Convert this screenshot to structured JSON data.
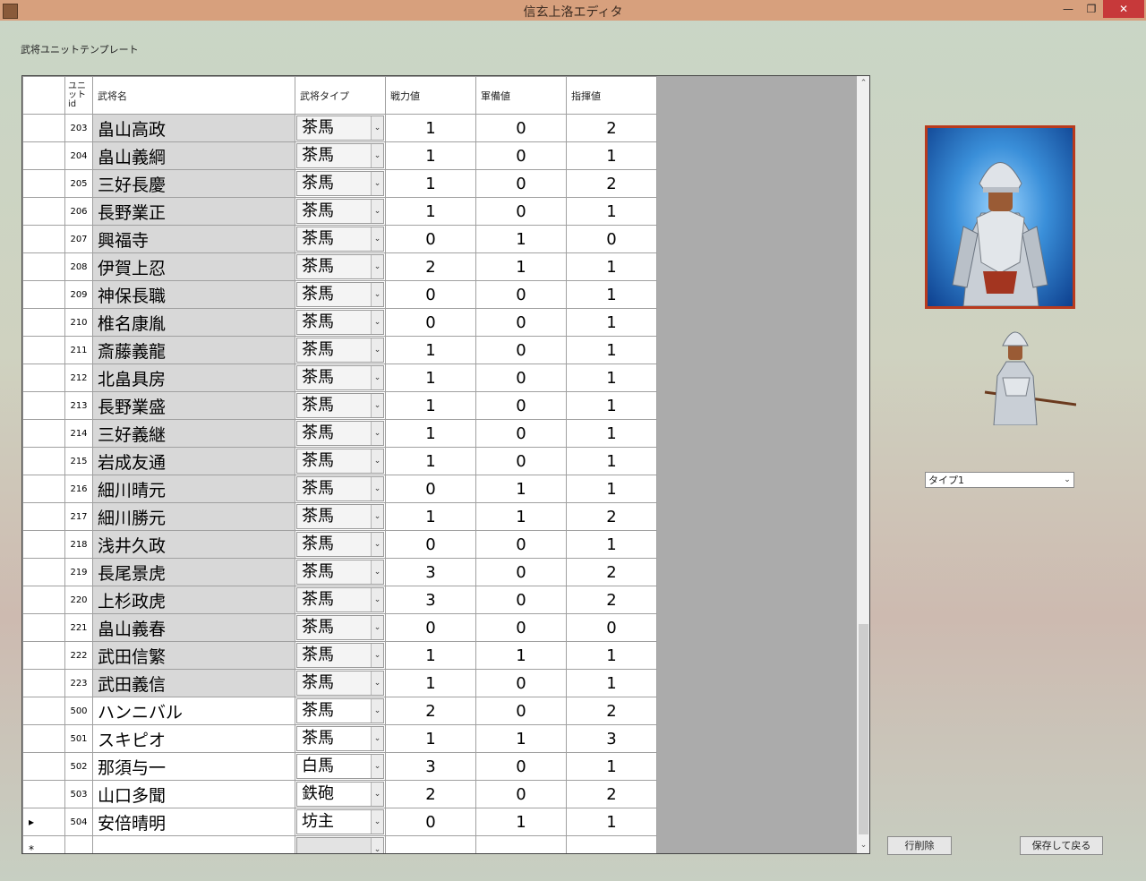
{
  "window": {
    "title": "信玄上洛エディタ",
    "controls": {
      "minimize": "—",
      "maximize": "❐",
      "close": "✕"
    }
  },
  "section_label": "武将ユニットテンプレート",
  "grid": {
    "headers": {
      "id": "ユニ\nット\nid",
      "name": "武将名",
      "type": "武将タイプ",
      "power": "戦力値",
      "armament": "軍備値",
      "command": "指揮値"
    },
    "rows": [
      {
        "id": "203",
        "name": "畠山高政",
        "type": "茶馬",
        "power": "1",
        "armament": "0",
        "command": "2",
        "gray": true
      },
      {
        "id": "204",
        "name": "畠山義綱",
        "type": "茶馬",
        "power": "1",
        "armament": "0",
        "command": "1",
        "gray": true
      },
      {
        "id": "205",
        "name": "三好長慶",
        "type": "茶馬",
        "power": "1",
        "armament": "0",
        "command": "2",
        "gray": true
      },
      {
        "id": "206",
        "name": "長野業正",
        "type": "茶馬",
        "power": "1",
        "armament": "0",
        "command": "1",
        "gray": true
      },
      {
        "id": "207",
        "name": "興福寺",
        "type": "茶馬",
        "power": "0",
        "armament": "1",
        "command": "0",
        "gray": true
      },
      {
        "id": "208",
        "name": "伊賀上忍",
        "type": "茶馬",
        "power": "2",
        "armament": "1",
        "command": "1",
        "gray": true
      },
      {
        "id": "209",
        "name": "神保長職",
        "type": "茶馬",
        "power": "0",
        "armament": "0",
        "command": "1",
        "gray": true
      },
      {
        "id": "210",
        "name": "椎名康胤",
        "type": "茶馬",
        "power": "0",
        "armament": "0",
        "command": "1",
        "gray": true
      },
      {
        "id": "211",
        "name": "斎藤義龍",
        "type": "茶馬",
        "power": "1",
        "armament": "0",
        "command": "1",
        "gray": true
      },
      {
        "id": "212",
        "name": "北畠具房",
        "type": "茶馬",
        "power": "1",
        "armament": "0",
        "command": "1",
        "gray": true
      },
      {
        "id": "213",
        "name": "長野業盛",
        "type": "茶馬",
        "power": "1",
        "armament": "0",
        "command": "1",
        "gray": true
      },
      {
        "id": "214",
        "name": "三好義継",
        "type": "茶馬",
        "power": "1",
        "armament": "0",
        "command": "1",
        "gray": true
      },
      {
        "id": "215",
        "name": "岩成友通",
        "type": "茶馬",
        "power": "1",
        "armament": "0",
        "command": "1",
        "gray": true
      },
      {
        "id": "216",
        "name": "細川晴元",
        "type": "茶馬",
        "power": "0",
        "armament": "1",
        "command": "1",
        "gray": true
      },
      {
        "id": "217",
        "name": "細川勝元",
        "type": "茶馬",
        "power": "1",
        "armament": "1",
        "command": "2",
        "gray": true
      },
      {
        "id": "218",
        "name": "浅井久政",
        "type": "茶馬",
        "power": "0",
        "armament": "0",
        "command": "1",
        "gray": true
      },
      {
        "id": "219",
        "name": "長尾景虎",
        "type": "茶馬",
        "power": "3",
        "armament": "0",
        "command": "2",
        "gray": true
      },
      {
        "id": "220",
        "name": "上杉政虎",
        "type": "茶馬",
        "power": "3",
        "armament": "0",
        "command": "2",
        "gray": true
      },
      {
        "id": "221",
        "name": "畠山義春",
        "type": "茶馬",
        "power": "0",
        "armament": "0",
        "command": "0",
        "gray": true
      },
      {
        "id": "222",
        "name": "武田信繁",
        "type": "茶馬",
        "power": "1",
        "armament": "1",
        "command": "1",
        "gray": true
      },
      {
        "id": "223",
        "name": "武田義信",
        "type": "茶馬",
        "power": "1",
        "armament": "0",
        "command": "1",
        "gray": true
      },
      {
        "id": "500",
        "name": "ハンニバル",
        "type": "茶馬",
        "power": "2",
        "armament": "0",
        "command": "2",
        "gray": false
      },
      {
        "id": "501",
        "name": "スキピオ",
        "type": "茶馬",
        "power": "1",
        "armament": "1",
        "command": "3",
        "gray": false
      },
      {
        "id": "502",
        "name": "那須与一",
        "type": "白馬",
        "power": "3",
        "armament": "0",
        "command": "1",
        "gray": false
      },
      {
        "id": "503",
        "name": "山口多聞",
        "type": "鉄砲",
        "power": "2",
        "armament": "0",
        "command": "2",
        "gray": false
      },
      {
        "id": "504",
        "name": "安倍晴明",
        "type": "坊主",
        "power": "0",
        "armament": "1",
        "command": "1",
        "gray": false,
        "current": true
      }
    ],
    "current_row_marker": "▸",
    "new_row_marker": "*",
    "dropdown_arrow": "⌄"
  },
  "type_select": {
    "value": "タイプ1",
    "arrow": "⌄"
  },
  "buttons": {
    "delete_row": "行削除",
    "save_return": "保存して戻る"
  },
  "icons": {
    "scroll_up": "⌃",
    "scroll_down": "⌄"
  }
}
